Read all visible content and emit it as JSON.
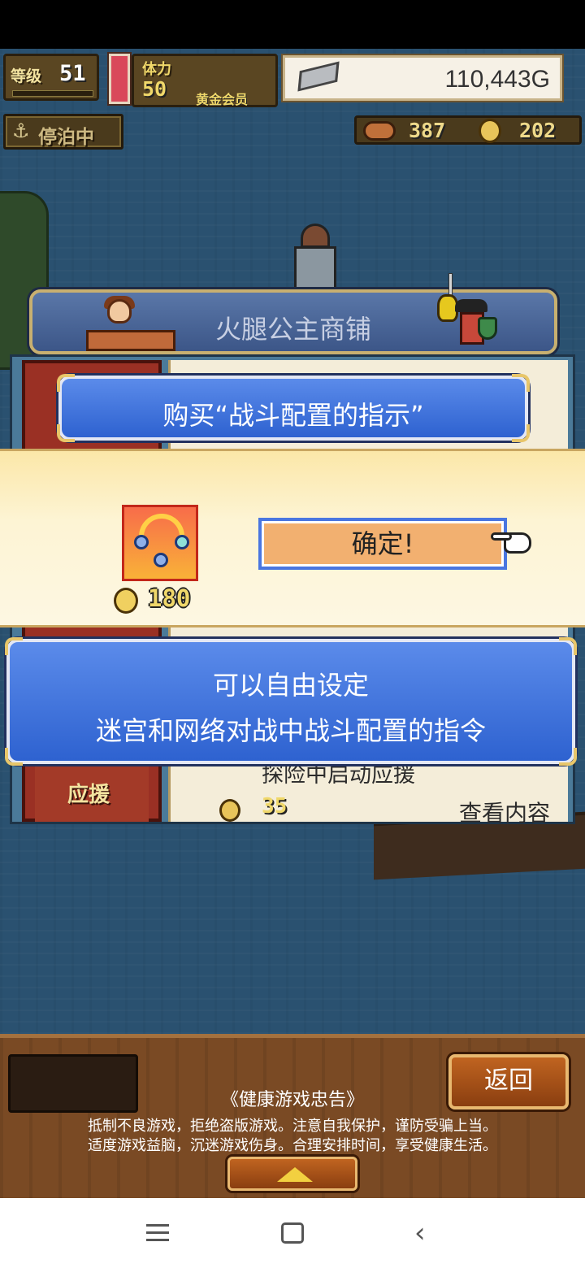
{
  "hud": {
    "level_label": "等级",
    "level": "51",
    "stamina_label": "体力",
    "stamina": "50",
    "membership": "黄金会员",
    "gold": "110,443G",
    "status": "停泊中",
    "medals": "387",
    "coins": "202"
  },
  "shop": {
    "title": "火腿公主商铺",
    "visible_item": {
      "description": "探险中启动应援",
      "price": "35",
      "view_label": "查看内容",
      "card_label": "应援"
    }
  },
  "purchase_dialog": {
    "title": "购买“战斗配置的指示”",
    "price": "180",
    "confirm_label": "确定!",
    "description_lines": [
      "可以自由设定",
      "迷宫和网络对战中战斗配置的指令"
    ]
  },
  "footer": {
    "back_label": "返回",
    "advice_title": "《健康游戏忠告》",
    "advice_lines": [
      "抵制不良游戏，拒绝盗版游戏。注意自我保护，谨防受骗上当。",
      "适度游戏益脑，沉迷游戏伤身。合理安排时间，享受健康生活。"
    ]
  },
  "icons": {
    "gold": "gold-bar-icon",
    "anchor": "anchor-icon",
    "medal": "medal-icon",
    "coin": "coin-icon",
    "item": "battle-formation-icon",
    "pointer": "pointing-hand-icon"
  },
  "colors": {
    "dialog_blue": "#2e62d0",
    "band_cream": "#fdf4d4",
    "confirm_fill": "#f2b070",
    "wood": "#7a4a24",
    "sea": "#2a5170"
  }
}
